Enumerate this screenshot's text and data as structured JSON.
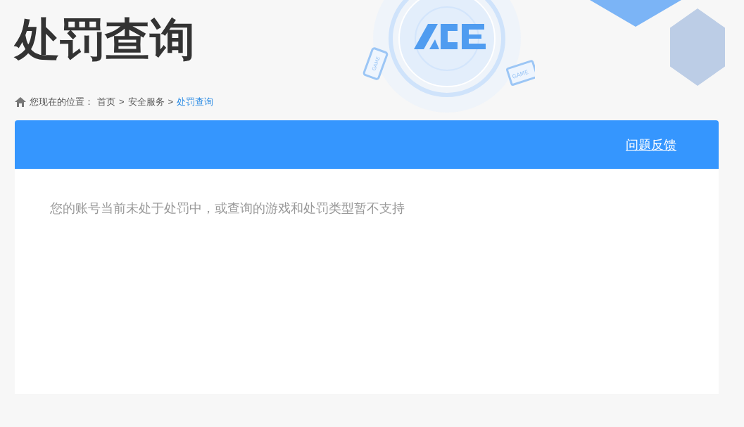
{
  "page_title": "处罚查询",
  "banner": {
    "device_labels": [
      "GAME",
      "GAME"
    ]
  },
  "breadcrumb": {
    "label": "您现在的位置：",
    "separators": [
      ">",
      ">"
    ],
    "items": [
      {
        "text": "首页",
        "selected": false
      },
      {
        "text": "安全服务",
        "selected": false
      },
      {
        "text": "处罚查询",
        "selected": true
      }
    ]
  },
  "panel": {
    "feedback_link": "问题反馈",
    "message": "您的账号当前未处于处罚中，或查询的游戏和处罚类型暂不支持"
  }
}
